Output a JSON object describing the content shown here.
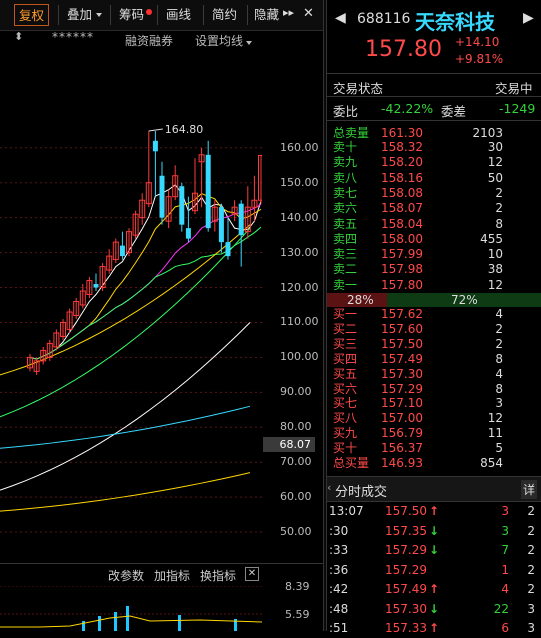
{
  "toolbar": {
    "items": [
      "复权",
      "叠加",
      "筹码",
      "画线",
      "简约",
      "隐藏"
    ],
    "more_icon": "double-chevron-right"
  },
  "chart_header": {
    "funding_label": "融资融券",
    "settings_label": "设置均线",
    "marks": "******"
  },
  "chart_data": {
    "type": "candlestick",
    "ylim": [
      44,
      108
    ],
    "yticks": [
      160.0,
      150.0,
      140.0,
      130.0,
      120.0,
      110.0,
      100.0,
      90.0,
      80.0,
      70.0,
      60.0,
      50.0
    ],
    "ytick_labels": [
      "160.00",
      "150.00",
      "140.00",
      "130.00",
      "120.00",
      "110.00",
      "100.00",
      "90.00",
      "80.00",
      "70.00",
      "60.00",
      "50.00"
    ],
    "high_annotation": "164.80",
    "current_price_label": "68.07",
    "candles": [
      {
        "o": 97,
        "c": 100,
        "h": 101,
        "l": 96
      },
      {
        "o": 96,
        "c": 99,
        "h": 100,
        "l": 95
      },
      {
        "o": 99,
        "c": 102,
        "h": 103,
        "l": 98
      },
      {
        "o": 100,
        "c": 104,
        "h": 105,
        "l": 99
      },
      {
        "o": 103,
        "c": 107,
        "h": 108,
        "l": 102
      },
      {
        "o": 106,
        "c": 110,
        "h": 111,
        "l": 105
      },
      {
        "o": 108,
        "c": 113,
        "h": 114,
        "l": 107
      },
      {
        "o": 112,
        "c": 116,
        "h": 117,
        "l": 111
      },
      {
        "o": 115,
        "c": 119,
        "h": 121,
        "l": 114
      },
      {
        "o": 118,
        "c": 122,
        "h": 123,
        "l": 117
      },
      {
        "o": 121,
        "c": 120,
        "h": 124,
        "l": 119
      },
      {
        "o": 120,
        "c": 126,
        "h": 127,
        "l": 119
      },
      {
        "o": 125,
        "c": 129,
        "h": 131,
        "l": 124
      },
      {
        "o": 128,
        "c": 133,
        "h": 134,
        "l": 127
      },
      {
        "o": 132,
        "c": 129,
        "h": 136,
        "l": 128
      },
      {
        "o": 130,
        "c": 136,
        "h": 137,
        "l": 129
      },
      {
        "o": 135,
        "c": 141,
        "h": 142,
        "l": 134
      },
      {
        "o": 140,
        "c": 145,
        "h": 147,
        "l": 138
      },
      {
        "o": 144,
        "c": 150,
        "h": 164.8,
        "l": 143
      },
      {
        "o": 162,
        "c": 159,
        "h": 164.8,
        "l": 146
      },
      {
        "o": 152,
        "c": 140,
        "h": 156,
        "l": 138
      },
      {
        "o": 139,
        "c": 146,
        "h": 148,
        "l": 137
      },
      {
        "o": 146,
        "c": 152,
        "h": 155,
        "l": 145
      },
      {
        "o": 149,
        "c": 138,
        "h": 150,
        "l": 136
      },
      {
        "o": 137,
        "c": 134,
        "h": 146,
        "l": 133
      },
      {
        "o": 142,
        "c": 147,
        "h": 157,
        "l": 141
      },
      {
        "o": 156,
        "c": 158,
        "h": 160,
        "l": 143
      },
      {
        "o": 158,
        "c": 137,
        "h": 162,
        "l": 136
      },
      {
        "o": 139,
        "c": 143,
        "h": 145,
        "l": 136
      },
      {
        "o": 143,
        "c": 133,
        "h": 144,
        "l": 130
      },
      {
        "o": 133,
        "c": 129,
        "h": 140,
        "l": 128
      },
      {
        "o": 141,
        "c": 143,
        "h": 145,
        "l": 139
      },
      {
        "o": 144,
        "c": 135,
        "h": 145,
        "l": 126
      },
      {
        "o": 136,
        "c": 143,
        "h": 149,
        "l": 134
      },
      {
        "o": 143,
        "c": 145,
        "h": 152,
        "l": 139
      },
      {
        "o": 145,
        "c": 157.8,
        "h": 158,
        "l": 144
      }
    ]
  },
  "lower_pane": {
    "buttons": [
      "改参数",
      "加指标",
      "换指标"
    ],
    "close_icon": "close",
    "ytick_labels": [
      "8.39",
      "5.59"
    ]
  },
  "quote": {
    "code": "688116",
    "name": "天奈科技",
    "price": "157.80",
    "change": "+14.10",
    "change_pct": "+9.81%",
    "status_label": "交易状态",
    "status_value": "交易中",
    "ratio_label": "委比",
    "ratio_value": "-42.22%",
    "diff_label": "委差",
    "diff_value": "-1249",
    "total_sell": {
      "label": "总卖量",
      "price": "161.30",
      "vol": "2103"
    },
    "asks": [
      {
        "label": "卖十",
        "price": "158.32",
        "vol": "30"
      },
      {
        "label": "卖九",
        "price": "158.20",
        "vol": "12"
      },
      {
        "label": "卖八",
        "price": "158.16",
        "vol": "50"
      },
      {
        "label": "卖七",
        "price": "158.08",
        "vol": "2"
      },
      {
        "label": "卖六",
        "price": "158.07",
        "vol": "2"
      },
      {
        "label": "卖五",
        "price": "158.04",
        "vol": "8"
      },
      {
        "label": "卖四",
        "price": "158.00",
        "vol": "455"
      },
      {
        "label": "卖三",
        "price": "157.99",
        "vol": "10"
      },
      {
        "label": "卖二",
        "price": "157.98",
        "vol": "38"
      },
      {
        "label": "卖一",
        "price": "157.80",
        "vol": "12"
      }
    ],
    "bar_left": "28%",
    "bar_right": "72%",
    "bar_split": 0.28,
    "bids": [
      {
        "label": "买一",
        "price": "157.62",
        "vol": "4"
      },
      {
        "label": "买二",
        "price": "157.60",
        "vol": "2"
      },
      {
        "label": "买三",
        "price": "157.50",
        "vol": "2"
      },
      {
        "label": "买四",
        "price": "157.49",
        "vol": "8"
      },
      {
        "label": "买五",
        "price": "157.30",
        "vol": "4"
      },
      {
        "label": "买六",
        "price": "157.29",
        "vol": "8"
      },
      {
        "label": "买七",
        "price": "157.10",
        "vol": "3"
      },
      {
        "label": "买八",
        "price": "157.00",
        "vol": "12"
      },
      {
        "label": "买九",
        "price": "156.79",
        "vol": "11"
      },
      {
        "label": "买十",
        "price": "156.37",
        "vol": "5"
      }
    ],
    "total_buy": {
      "label": "总买量",
      "price": "146.93",
      "vol": "854"
    }
  },
  "ticks": {
    "title": "分时成交",
    "detail": "详",
    "rows": [
      {
        "time": "13:07",
        "price": "157.50",
        "dir": "up",
        "vol": "3",
        "n": "2"
      },
      {
        "time": ":30",
        "price": "157.35",
        "dir": "down",
        "vol": "3",
        "n": "2"
      },
      {
        "time": ":33",
        "price": "157.29",
        "dir": "down",
        "vol": "7",
        "n": "2"
      },
      {
        "time": ":36",
        "price": "157.29",
        "dir": "",
        "vol": "1",
        "n": "2"
      },
      {
        "time": ":42",
        "price": "157.49",
        "dir": "up",
        "vol": "4",
        "n": "2"
      },
      {
        "time": ":48",
        "price": "157.30",
        "dir": "down",
        "vol": "22",
        "n": "3"
      },
      {
        "time": ":51",
        "price": "157.33",
        "dir": "up",
        "vol": "6",
        "n": "3"
      }
    ]
  }
}
